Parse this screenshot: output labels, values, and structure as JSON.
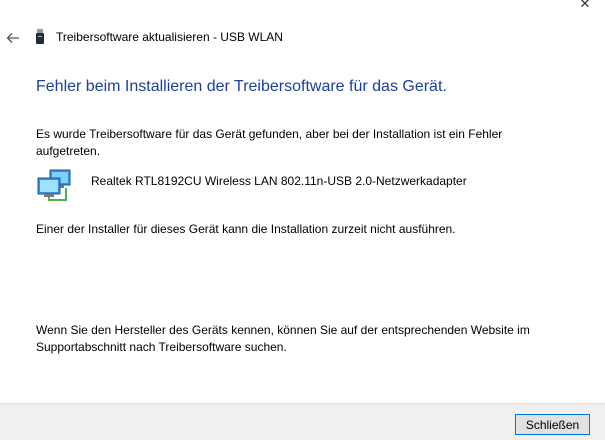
{
  "window": {
    "close_glyph": "✕"
  },
  "titlebar": {
    "title": "Treibersoftware aktualisieren - USB WLAN",
    "back_icon": "back-arrow-icon",
    "device_icon": "usb-device-icon"
  },
  "content": {
    "heading": "Fehler beim Installieren der Treibersoftware für das Gerät.",
    "description": "Es wurde Treibersoftware für das Gerät gefunden, aber bei der Installation ist ein Fehler aufgetreten.",
    "device": {
      "icon": "network-adapter-icon",
      "name": "Realtek RTL8192CU Wireless LAN 802.11n-USB 2.0-Netzwerkadapter"
    },
    "error_message": "Einer der Installer für dieses Gerät kann die Installation zurzeit nicht ausführen.",
    "hint": "Wenn Sie den Hersteller des Geräts kennen, können Sie auf der entsprechenden Website im Supportabschnitt nach Treibersoftware suchen."
  },
  "footer": {
    "close_label": "Schließen"
  },
  "colors": {
    "heading": "#1a3fa0",
    "button_border": "#0078d7",
    "footer_bg": "#f0f0f0"
  }
}
